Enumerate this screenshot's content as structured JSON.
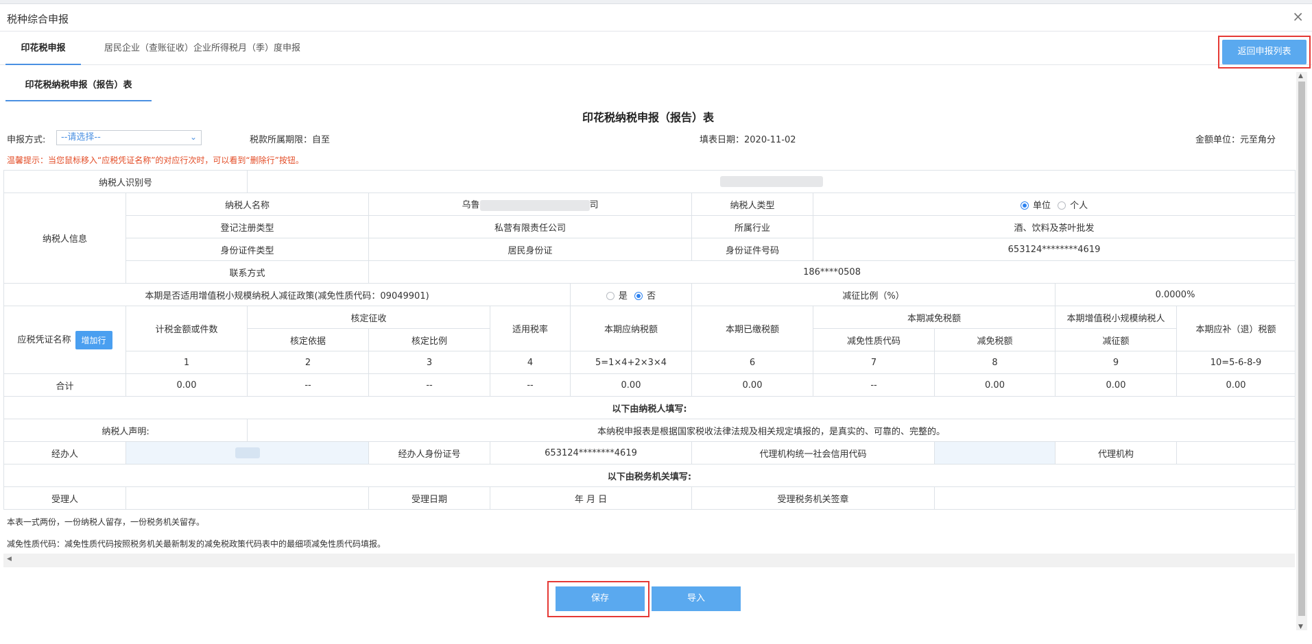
{
  "window": {
    "title": "税种综合申报",
    "close_glyph": "×"
  },
  "tabs": [
    {
      "label": "印花税申报",
      "active": true
    },
    {
      "label": "居民企业（查账征收）企业所得税月（季）度申报",
      "active": false
    }
  ],
  "return_button": "返回申报列表",
  "subtab": "印花税纳税申报（报告）表",
  "form": {
    "title": "印花税纳税申报（报告）表",
    "method_label": "申报方式:",
    "method_value": "--请选择--",
    "period_label": "税款所属期限：自至",
    "fill_date": "填表日期：2020-11-02",
    "unit": "金额单位：元至角分",
    "tip": "温馨提示：当您鼠标移入“应税凭证名称”的对应行次时，可以看到“删除行”按钮。"
  },
  "taxpayer": {
    "id_label": "纳税人识别号",
    "info_label": "纳税人信息",
    "name_label": "纳税人名称",
    "name_prefix": "乌鲁",
    "name_suffix": "司",
    "type_label": "纳税人类型",
    "type_opt1": "单位",
    "type_opt2": "个人",
    "reg_type_label": "登记注册类型",
    "reg_type_value": "私营有限责任公司",
    "industry_label": "所属行业",
    "industry_value": "酒、饮料及茶叶批发",
    "idtype_label": "身份证件类型",
    "idtype_value": "居民身份证",
    "idno_label": "身份证件号码",
    "idno_value": "653124********4619",
    "contact_label": "联系方式",
    "contact_value": "186****0508"
  },
  "policy": {
    "question": "本期是否适用增值税小规模纳税人减征政策(减免性质代码：09049901)",
    "yes": "是",
    "no": "否",
    "ratio_label": "减征比例（%）",
    "ratio_value": "0.0000%"
  },
  "grid": {
    "h_name": "应税凭证名称",
    "add_row": "增加行",
    "h_amount": "计税金额或件数",
    "h_verified": "核定征收",
    "h_basis": "核定依据",
    "h_ratio": "核定比例",
    "h_rate": "适用税率",
    "h_payable": "本期应纳税额",
    "h_paid": "本期已缴税额",
    "h_relief": "本期减免税额",
    "h_relief_code": "减免性质代码",
    "h_relief_amt": "减免税额",
    "h_small1": "本期增值税小规模纳税人",
    "h_small2": "减征额",
    "h_due": "本期应补（退）税额",
    "nums": [
      "1",
      "2",
      "3",
      "4",
      "5=1×4+2×3×4",
      "6",
      "7",
      "8",
      "9",
      "10=5-6-8-9"
    ],
    "total_label": "合计",
    "totals": [
      "0.00",
      "--",
      "--",
      "--",
      "0.00",
      "0.00",
      "--",
      "0.00",
      "0.00",
      "0.00"
    ]
  },
  "declare": {
    "section": "以下由纳税人填写:",
    "statement_label": "纳税人声明:",
    "statement": "本纳税申报表是根据国家税收法律法规及相关规定填报的，是真实的、可靠的、完整的。",
    "handler_label": "经办人",
    "handler_id_label": "经办人身份证号",
    "handler_id_value": "653124********4619",
    "agent_code_label": "代理机构统一社会信用代码",
    "agent_label": "代理机构"
  },
  "office": {
    "section": "以下由税务机关填写:",
    "receiver_label": "受理人",
    "date_label": "受理日期",
    "date_value": "年 月 日",
    "seal_label": "受理税务机关签章"
  },
  "notes": [
    "本表一式两份，一份纳税人留存，一份税务机关留存。",
    "减免性质代码：减免性质代码按照税务机关最新制发的减免税政策代码表中的最细项减免性质代码填报。"
  ],
  "buttons": {
    "save": "保存",
    "import": "导入"
  },
  "colors": {
    "accent": "#5aa9ef",
    "highlight": "#e53935",
    "tip": "#e34c26"
  }
}
